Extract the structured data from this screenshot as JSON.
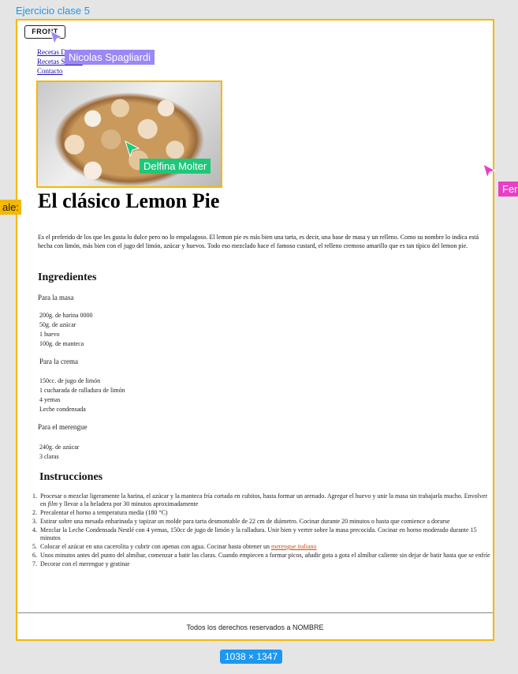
{
  "canvas": {
    "frame_title": "Ejercicio clase  5",
    "frame_size": "1038 × 1347"
  },
  "page": {
    "logo": "FRONT",
    "nav": [
      "Recetas Dulces",
      "Recetas Saladas",
      "Contacto"
    ],
    "title": "El clásico Lemon Pie",
    "intro": "Es el preferido de los que les gusta lo dulce pero no lo empalagoso. El lemon pie es más bien una tarta, es decir, una base de masa y un relleno. Como su nombre lo indica está hecha con limón, más bien con el jugo del limón, azúcar y huevos. Todo eso mezclado hace el famoso custard, el relleno cremoso amarillo que es tan típico del lemon pie.",
    "ingredients_heading": "Ingredientes",
    "masa_heading": "Para la masa",
    "masa_items": [
      "200g. de harina 0000",
      "50g. de azúcar",
      "1 huevo",
      "100g. de manteca"
    ],
    "crema_heading": "Para la crema",
    "crema_items": [
      "150cc. de jugo de limón",
      "1 cucharada de ralladura de limón",
      "4 yemas",
      "Leche condensada"
    ],
    "merengue_heading": "Para el merengue",
    "merengue_items": [
      "240g. de azúcar",
      "3 claras"
    ],
    "instructions_heading": "Instrucciones",
    "steps": {
      "s1_a": "Procesar o mezclar ligeramente la harina, el azúcar y la manteca fría cortada en cubitos, hasta formar un arenado. Agregar el huevo y unir la masa sin trabajarla mucho. Envolver en ",
      "s1_em": "film",
      "s1_b": " y llevar a la heladera por 30 minutos aproximadamente",
      "s2": "Precalentar el horno a temperatura media (180 °C)",
      "s3": "Estirar sobre una mesada enharinada y tapizar un molde para tarta desmontable de 22 cm de diámetro. Cocinar durante 20 minutos o hasta que comience a dorarse",
      "s4": "Mezclar la Leche Condensada Nestlé con 4 yemas, 150cc de jugo de limón y la ralladura. Unir bien y verter sobre la masa precocida. Cocinar en horno moderado durante 15 minutos",
      "s5_a": "Colocar el azúcar en una cacerolita y cubrir con apenas con agua. Cocinar hasta obtener un ",
      "s5_link": "merengue italiano",
      "s6": "Unos minutos antes del punto del almíbar, comenzar a batir las claras. Cuando empiecen a formar picos, añadir gota a gota el almíbar caliente sin dejar de batir hasta que se enfríe",
      "s7": "Decorar con el merengue y gratinar"
    },
    "footer": "Todos los derechos reservados a NOMBRE"
  },
  "collaborators": {
    "nicolas": "Nicolas Spagliardi",
    "delfina": "Delfina Molter",
    "left_tag": "ale:",
    "right_tag": "Fer"
  },
  "colors": {
    "nicolas": "#9b87f5",
    "delfina": "#1ec77a",
    "left_tag": "#f5b800",
    "right_tag": "#e83fc4",
    "selection": "#f5b800",
    "figma_blue": "#1d97f0"
  }
}
